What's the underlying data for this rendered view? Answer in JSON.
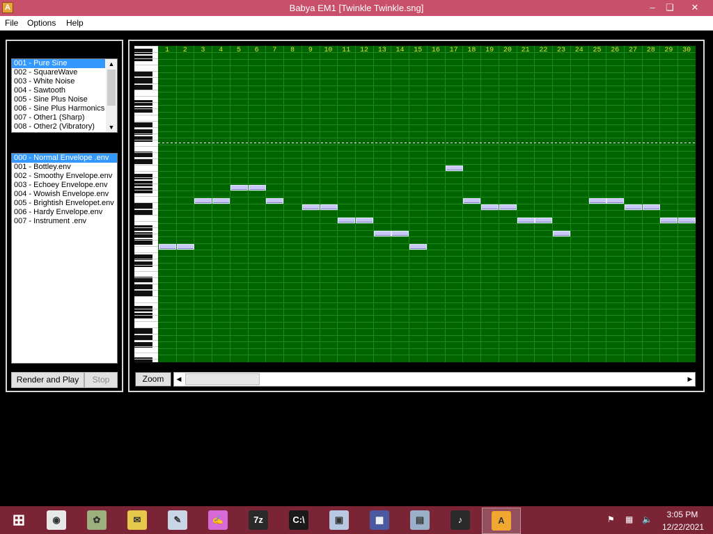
{
  "window": {
    "title": "Babya EM1 [Twinkle Twinkle.sng]",
    "icon_letter": "A"
  },
  "menu": [
    "File",
    "Options",
    "Help"
  ],
  "waves": {
    "items": [
      "001 - Pure Sine",
      "002 - SquareWave",
      "003 - White Noise",
      "004 - Sawtooth",
      "005 - Sine Plus Noise",
      "006 - Sine Plus Harmonics",
      "007 - Other1 (Sharp)",
      "008 - Other2 (Vibratory)"
    ],
    "selected": 0
  },
  "envelopes": {
    "items": [
      "000 - Normal Envelope .env",
      "001 - Bottley.env",
      "002 - Smoothy Envelope.env",
      "003 - Echoey Envelope.env",
      "004 - Wowish Envelope.env",
      "005 - Brightish Envelopet.env",
      "006 - Hardy Envelope.env",
      "007 - Instrument .env"
    ],
    "selected": 0
  },
  "buttons": {
    "render": "Render and Play",
    "stop": "Stop",
    "zoom": "Zoom"
  },
  "columns": [
    "1",
    "2",
    "3",
    "4",
    "5",
    "6",
    "7",
    "8",
    "9",
    "10",
    "11",
    "12",
    "13",
    "14",
    "15",
    "16",
    "17",
    "18",
    "19",
    "20",
    "21",
    "22",
    "23",
    "24",
    "25",
    "26",
    "27",
    "28",
    "29",
    "30"
  ],
  "notes": [
    {
      "col": 1,
      "row": 15
    },
    {
      "col": 2,
      "row": 15
    },
    {
      "col": 3,
      "row": 11
    },
    {
      "col": 4,
      "row": 11
    },
    {
      "col": 5,
      "row": 10
    },
    {
      "col": 6,
      "row": 10
    },
    {
      "col": 7,
      "row": 11
    },
    {
      "col": 9,
      "row": 12
    },
    {
      "col": 10,
      "row": 12
    },
    {
      "col": 11,
      "row": 13
    },
    {
      "col": 12,
      "row": 13
    },
    {
      "col": 13,
      "row": 14
    },
    {
      "col": 14,
      "row": 14
    },
    {
      "col": 15,
      "row": 15
    },
    {
      "col": 17,
      "row": 8
    },
    {
      "col": 18,
      "row": 11
    },
    {
      "col": 19,
      "row": 12
    },
    {
      "col": 20,
      "row": 12
    },
    {
      "col": 21,
      "row": 13
    },
    {
      "col": 22,
      "row": 13
    },
    {
      "col": 23,
      "row": 14
    },
    {
      "col": 25,
      "row": 11
    },
    {
      "col": 26,
      "row": 11
    },
    {
      "col": 27,
      "row": 12
    },
    {
      "col": 28,
      "row": 12
    },
    {
      "col": 29,
      "row": 13
    },
    {
      "col": 30,
      "row": 13
    }
  ],
  "colors": {
    "grid_bg": "#006400",
    "grid_line": "#1e8a1e",
    "note": "#c8c8f8",
    "titlebar": "#c8506a",
    "taskbar": "#7a2436",
    "selection": "#3399ff"
  },
  "taskbar": {
    "apps": [
      "start-icon",
      "chrome-icon",
      "flower-app-icon",
      "mail-icon",
      "paint-icon",
      "paint-palette-icon",
      "7zip-icon",
      "cmd-icon",
      "media-icon",
      "babya-suite-icon",
      "notepad-icon",
      "piano-icon",
      "babya-em1-icon"
    ],
    "time": "3:05 PM",
    "date": "12/22/2021"
  }
}
